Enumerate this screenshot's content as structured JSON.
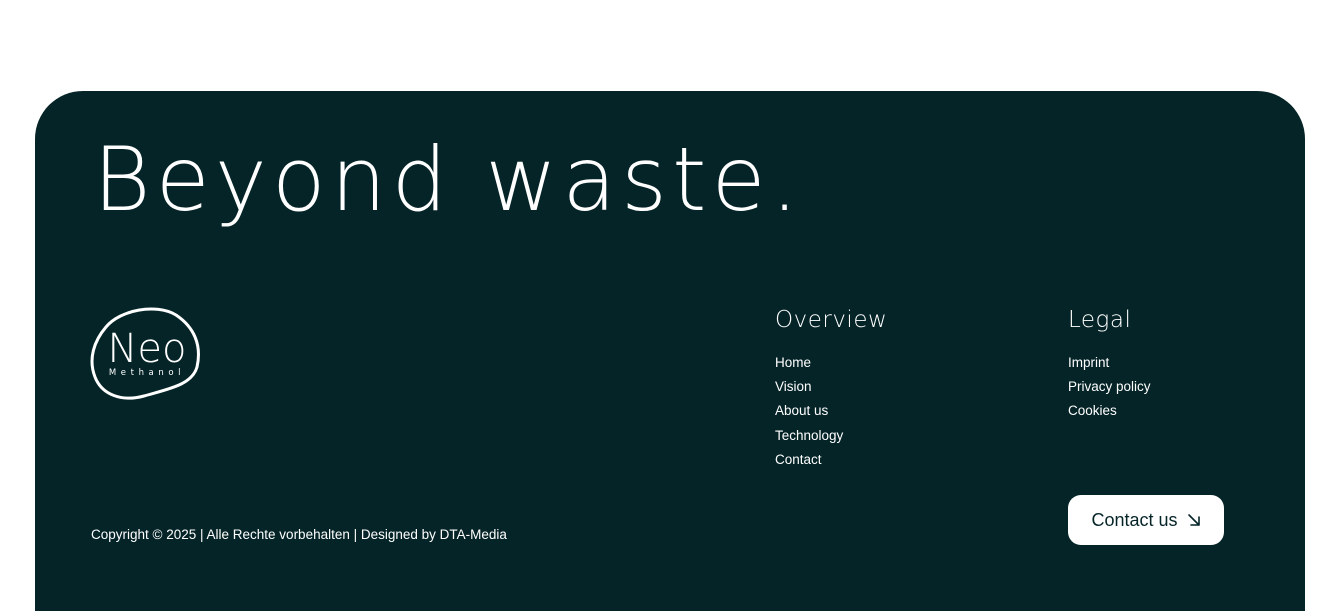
{
  "colors": {
    "footer_background": "#052427",
    "text": "#ffffff",
    "button_background": "#ffffff",
    "button_text": "#052427"
  },
  "footer": {
    "headline": "Beyond waste.",
    "logo": {
      "name": "Neo",
      "subtitle": "Methanol"
    },
    "overview": {
      "title": "Overview",
      "links": [
        "Home",
        "Vision",
        "About us",
        "Technology",
        "Contact"
      ]
    },
    "legal": {
      "title": "Legal",
      "links": [
        "Imprint",
        "Privacy policy",
        "Cookies"
      ]
    },
    "copyright": {
      "text": "Copyright © 2025 | Alle Rechte vorbehalten | Designed by ",
      "designer_link": "DTA-Media"
    },
    "contact_button": {
      "label": "Contact us",
      "icon": "arrow-down-right-icon"
    }
  }
}
